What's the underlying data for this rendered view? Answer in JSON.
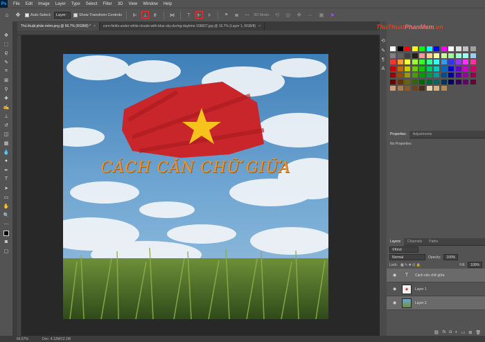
{
  "app": {
    "logo": "Ps"
  },
  "menu": [
    "File",
    "Edit",
    "Image",
    "Layer",
    "Type",
    "Select",
    "Filter",
    "3D",
    "View",
    "Window",
    "Help"
  ],
  "options": {
    "auto_select_label": "Auto-Select:",
    "auto_select_target": "Layer",
    "transform_label": "Show Transform Controls",
    "mode_3d": "3D Mode:"
  },
  "tabs": [
    {
      "label": "Thủ thuật phần mềm.png @ 66.7% (RGB/8) *",
      "active": true
    },
    {
      "label": "corn-fields-under-white-clouds-with-blue-sky-during-daytime-158827.jpg @ 16.7% (Layer 1, RGB/8)",
      "active": false
    }
  ],
  "canvas": {
    "title_text": "CÁCH CĂN CHỮ GIỮA",
    "text_color": "#e8942f",
    "flag_color": "#c8262a",
    "star_color": "#f6c21b"
  },
  "status": {
    "zoom": "66.67%",
    "doc": "Doc: 4.12M/12.1M"
  },
  "watermark": {
    "part1": "ThuThuat",
    "part2": "PhanMem",
    "part3": ".vn"
  },
  "properties": {
    "tabs": [
      "Properties",
      "Adjustments"
    ],
    "body": "No Properties"
  },
  "layers_panel": {
    "tabs": [
      "Layers",
      "Channels",
      "Paths"
    ],
    "kind_label": "Kind",
    "blend_mode": "Normal",
    "opacity_label": "Opacity:",
    "opacity_value": "100%",
    "lock_label": "Lock:",
    "fill_label": "Fill:",
    "fill_value": "100%",
    "layers": [
      {
        "name": "Cách căn chữ giữa",
        "type": "text",
        "selected": true
      },
      {
        "name": "Layer 1",
        "type": "image",
        "selected": false
      },
      {
        "name": "Layer 2",
        "type": "image",
        "selected": true
      }
    ]
  },
  "swatch_colors": [
    "#ffffff",
    "#000000",
    "#ff0000",
    "#ffff00",
    "#00ff00",
    "#00ffff",
    "#0000ff",
    "#ff00ff",
    "#ffffff",
    "#e0e0e0",
    "#c0c0c0",
    "#a0a0a0",
    "#808080",
    "#606060",
    "#404040",
    "#202020",
    "#ff9999",
    "#ffcc99",
    "#ffff99",
    "#ccff99",
    "#99ff99",
    "#99ffcc",
    "#99ffff",
    "#99ccff",
    "#ff3333",
    "#ff9933",
    "#ffff33",
    "#99ff33",
    "#33ff33",
    "#33ff99",
    "#33ffff",
    "#3399ff",
    "#3333ff",
    "#9933ff",
    "#ff33ff",
    "#ff3399",
    "#cc0000",
    "#cc6600",
    "#cccc00",
    "#66cc00",
    "#00cc00",
    "#00cc66",
    "#00cccc",
    "#0066cc",
    "#0000cc",
    "#6600cc",
    "#cc00cc",
    "#cc0066",
    "#990000",
    "#994c00",
    "#999900",
    "#4c9900",
    "#009900",
    "#00994c",
    "#009999",
    "#004c99",
    "#000099",
    "#4c0099",
    "#990099",
    "#99004c",
    "#660000",
    "#663300",
    "#666600",
    "#336600",
    "#006600",
    "#006633",
    "#006666",
    "#003366",
    "#000066",
    "#330066",
    "#660066",
    "#660033",
    "#c8a27a",
    "#a67c52",
    "#8b5a2b",
    "#6b4423",
    "#4a2f17",
    "#e8d3b0",
    "#d4b483",
    "#b08d57"
  ]
}
